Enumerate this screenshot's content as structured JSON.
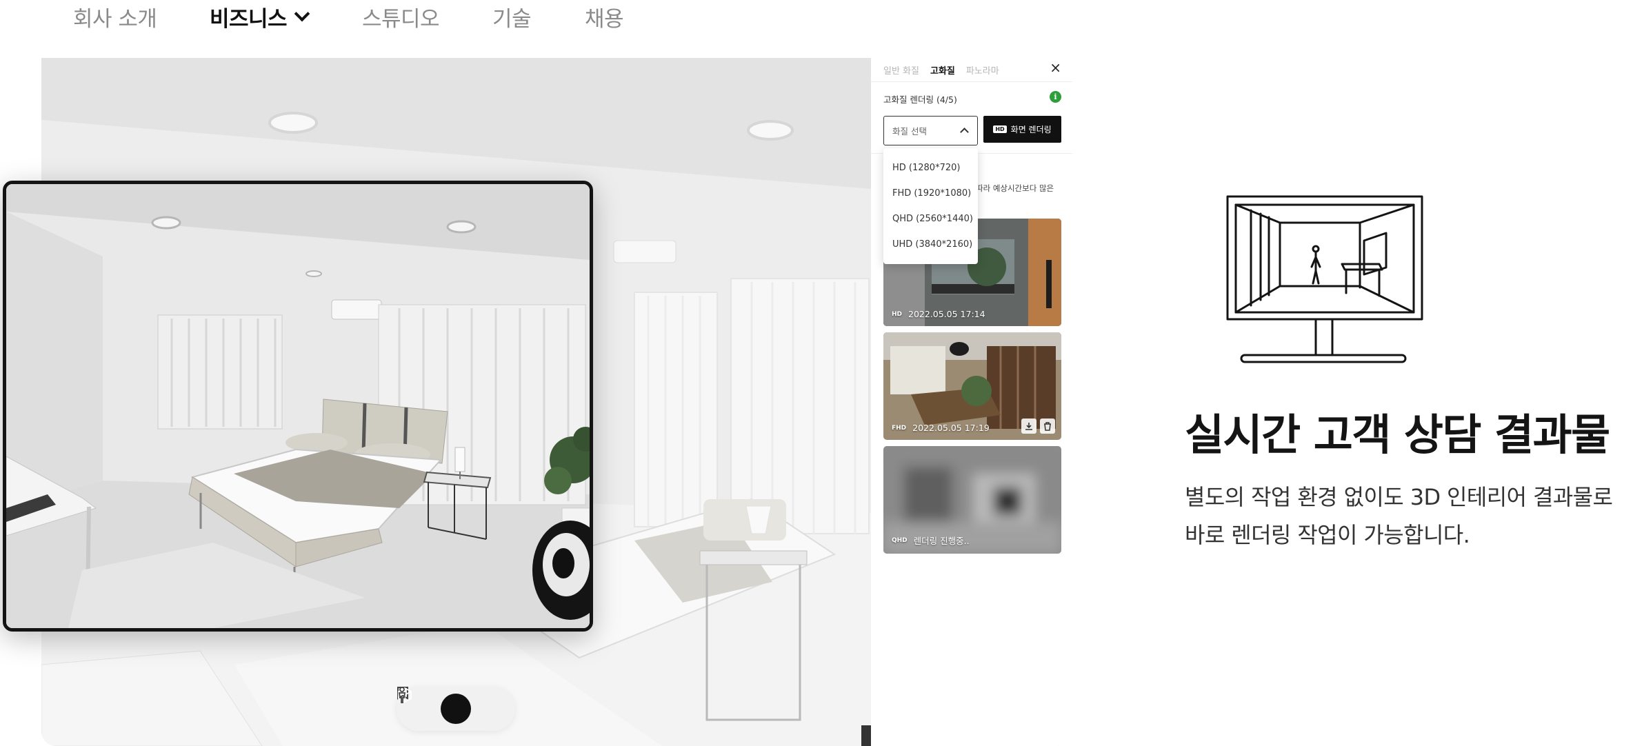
{
  "nav": {
    "items": [
      {
        "label": "회사 소개"
      },
      {
        "label": "비즈니스"
      },
      {
        "label": "스튜디오"
      },
      {
        "label": "기술"
      },
      {
        "label": "채용"
      }
    ]
  },
  "panel": {
    "tabs": [
      "일반 화질",
      "고화질",
      "파노라마"
    ],
    "close": "×",
    "render_title": "고화질 렌더링 (4/5)",
    "info": "i",
    "select_placeholder": "화질 선택",
    "render_button": "화면 렌더링",
    "render_button_chip": "HD",
    "note": "따라 예상시간보다 많은",
    "options": [
      "HD (1280*720)",
      "FHD (1920*1080)",
      "QHD (2560*1440)",
      "UHD (3840*2160)"
    ],
    "renders": [
      {
        "quality": "HD",
        "text": "2022.05.05 17:14"
      },
      {
        "quality": "FHD",
        "text": "2022.05.05 17:19"
      },
      {
        "quality": "QHD",
        "text": "렌더링 진행중.."
      }
    ]
  },
  "viewer": {
    "tools": [
      "floorplan-icon",
      "3d-cube-icon",
      "person-icon"
    ]
  },
  "feature": {
    "headline": "실시간 고객 상담 결과물",
    "desc_line1": "별도의 작업 환경 없이도 3D 인테리어 결과물로",
    "desc_line2": "바로 렌더링 작업이 가능합니다."
  }
}
